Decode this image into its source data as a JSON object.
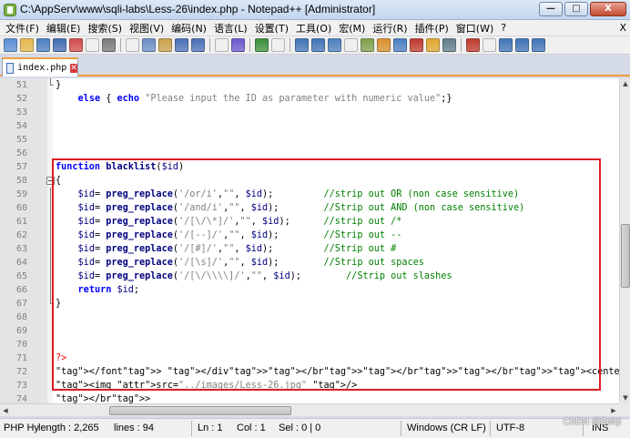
{
  "window": {
    "title": "C:\\AppServ\\www\\sqli-labs\\Less-26\\index.php - Notepad++ [Administrator]",
    "minimize_glyph": "—",
    "maximize_glyph": "□",
    "close_glyph": "X"
  },
  "menu": {
    "items": [
      "文件(F)",
      "编辑(E)",
      "搜索(S)",
      "视图(V)",
      "编码(N)",
      "语言(L)",
      "设置(T)",
      "工具(O)",
      "宏(M)",
      "运行(R)",
      "插件(P)",
      "窗口(W)",
      "?"
    ],
    "close_glyph": "X"
  },
  "toolbar": {
    "icons": [
      "new-file-icon",
      "open-file-icon",
      "save-icon",
      "save-all-icon",
      "close-icon",
      "close-all-icon",
      "print-icon",
      "cut-icon",
      "copy-icon",
      "paste-icon",
      "undo-icon",
      "redo-icon",
      "find-icon",
      "replace-icon",
      "zoom-in-icon",
      "zoom-out-icon",
      "sync-v-icon",
      "sync-h-icon",
      "word-wrap-icon",
      "show-all-chars-icon",
      "indent-guide-icon",
      "user-lang-icon",
      "doc-map-icon",
      "function-list-icon",
      "folder-workspace-icon",
      "monitor-icon",
      "record-macro-icon",
      "stop-record-icon",
      "play-macro-icon",
      "run-macro-multiple-icon",
      "save-macro-icon"
    ]
  },
  "tab": {
    "label": "index.php",
    "close_glyph": "✕"
  },
  "editor": {
    "lines": [
      {
        "n": "51",
        "code": "}"
      },
      {
        "n": "52",
        "code": "    else { echo \"Please input the ID as parameter with numeric value\";}"
      },
      {
        "n": "53",
        "code": ""
      },
      {
        "n": "54",
        "code": ""
      },
      {
        "n": "55",
        "code": ""
      },
      {
        "n": "56",
        "code": ""
      },
      {
        "n": "57",
        "code": "function blacklist($id)"
      },
      {
        "n": "58",
        "code": "{"
      },
      {
        "n": "59",
        "code": "    $id= preg_replace('/or/i',\"\", $id);         //strip out OR (non case sensitive)"
      },
      {
        "n": "60",
        "code": "    $id= preg_replace('/and/i',\"\", $id);        //Strip out AND (non case sensitive)"
      },
      {
        "n": "61",
        "code": "    $id= preg_replace('/[\\/\\*]/',\"\", $id);      //strip out /*"
      },
      {
        "n": "62",
        "code": "    $id= preg_replace('/[--]/',\"\", $id);        //Strip out --"
      },
      {
        "n": "63",
        "code": "    $id= preg_replace('/[#]/',\"\", $id);         //Strip out #"
      },
      {
        "n": "64",
        "code": "    $id= preg_replace('/[\\s]/',\"\", $id);        //Strip out spaces"
      },
      {
        "n": "65",
        "code": "    $id= preg_replace('/[\\/\\\\\\\\]/',\"\", $id);        //Strip out slashes"
      },
      {
        "n": "66",
        "code": "    return $id;"
      },
      {
        "n": "67",
        "code": "}"
      },
      {
        "n": "68",
        "code": ""
      },
      {
        "n": "69",
        "code": ""
      },
      {
        "n": "70",
        "code": ""
      },
      {
        "n": "71",
        "code": "?>"
      },
      {
        "n": "72",
        "code": "</font> </div></br></br></br><center>"
      },
      {
        "n": "73",
        "code": "<img src=\"../images/Less-26.jpg\" />"
      },
      {
        "n": "74",
        "code": "</br>"
      }
    ]
  },
  "status": {
    "lang": "PHP Hy",
    "length": "length : 2,265",
    "lines": "lines : 94",
    "ln": "Ln : 1",
    "col": "Col : 1",
    "sel": "Sel : 0 | 0",
    "eol": "Windows (CR LF)",
    "encoding": "UTF-8",
    "ins": "INS"
  },
  "watermark": "CSDN @Beiqi"
}
